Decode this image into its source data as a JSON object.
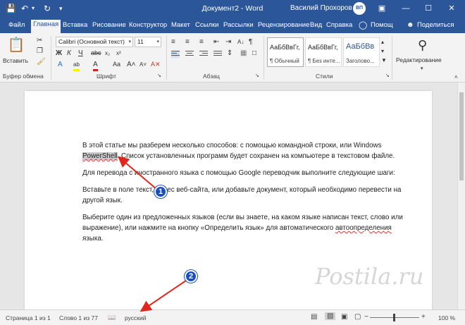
{
  "app": {
    "document_title": "Документ2 - Word",
    "user_name": "Василий Прохоров",
    "user_initials": "ВП"
  },
  "tabs": [
    "Файл",
    "Главная",
    "Вставка",
    "Рисование",
    "Конструктор",
    "Макет",
    "Ссылки",
    "Рассылки",
    "Рецензирование",
    "Вид",
    "Справка",
    "Помощ",
    "Поделиться"
  ],
  "ribbon": {
    "clipboard": {
      "paste_label": "Вставить",
      "group_label": "Буфер обмена"
    },
    "font": {
      "font_name": "Calibri (Основной текст)",
      "font_size": "11",
      "group_label": "Шрифт"
    },
    "paragraph": {
      "group_label": "Абзац"
    },
    "styles": {
      "group_label": "Стили",
      "items": [
        {
          "sample": "АаБбВвГг,",
          "name": "¶ Обычный"
        },
        {
          "sample": "АаБбВвГг,",
          "name": "¶ Без инте..."
        },
        {
          "sample": "АаБбВв",
          "name": "Заголово..."
        }
      ]
    },
    "editing": {
      "label": "Редактирование"
    }
  },
  "document": {
    "p1_before": "В этой статье мы разберем несколько способов: с помощью командной строки, или Windows ",
    "p1_highlight": "PowerShell",
    "p1_after": ". Список установленных программ будет сохранен на компьютере в текстовом файле.",
    "p2": "Для перевода с иностранного языка с помощью Google переводчик выполните следующие шаги:",
    "p3": "Вставьте в поле текст, адрес веб-сайта, или добавьте документ, который необходимо перевести на другой язык.",
    "p4_before": "Выберите один из предложенных языков (если вы знаете, на каком языке написан текст, слово или выражение), или нажмите на кнопку «Определить язык» для автоматического ",
    "p4_spell": "автоопределения",
    "p4_after": " языка."
  },
  "status": {
    "page": "Страница 1 из 1",
    "words": "Слово 1 из 77",
    "language": "русский",
    "zoom": "100 %"
  },
  "annotations": {
    "badge1": "1",
    "badge2": "2"
  },
  "watermark": "Postila.ru"
}
